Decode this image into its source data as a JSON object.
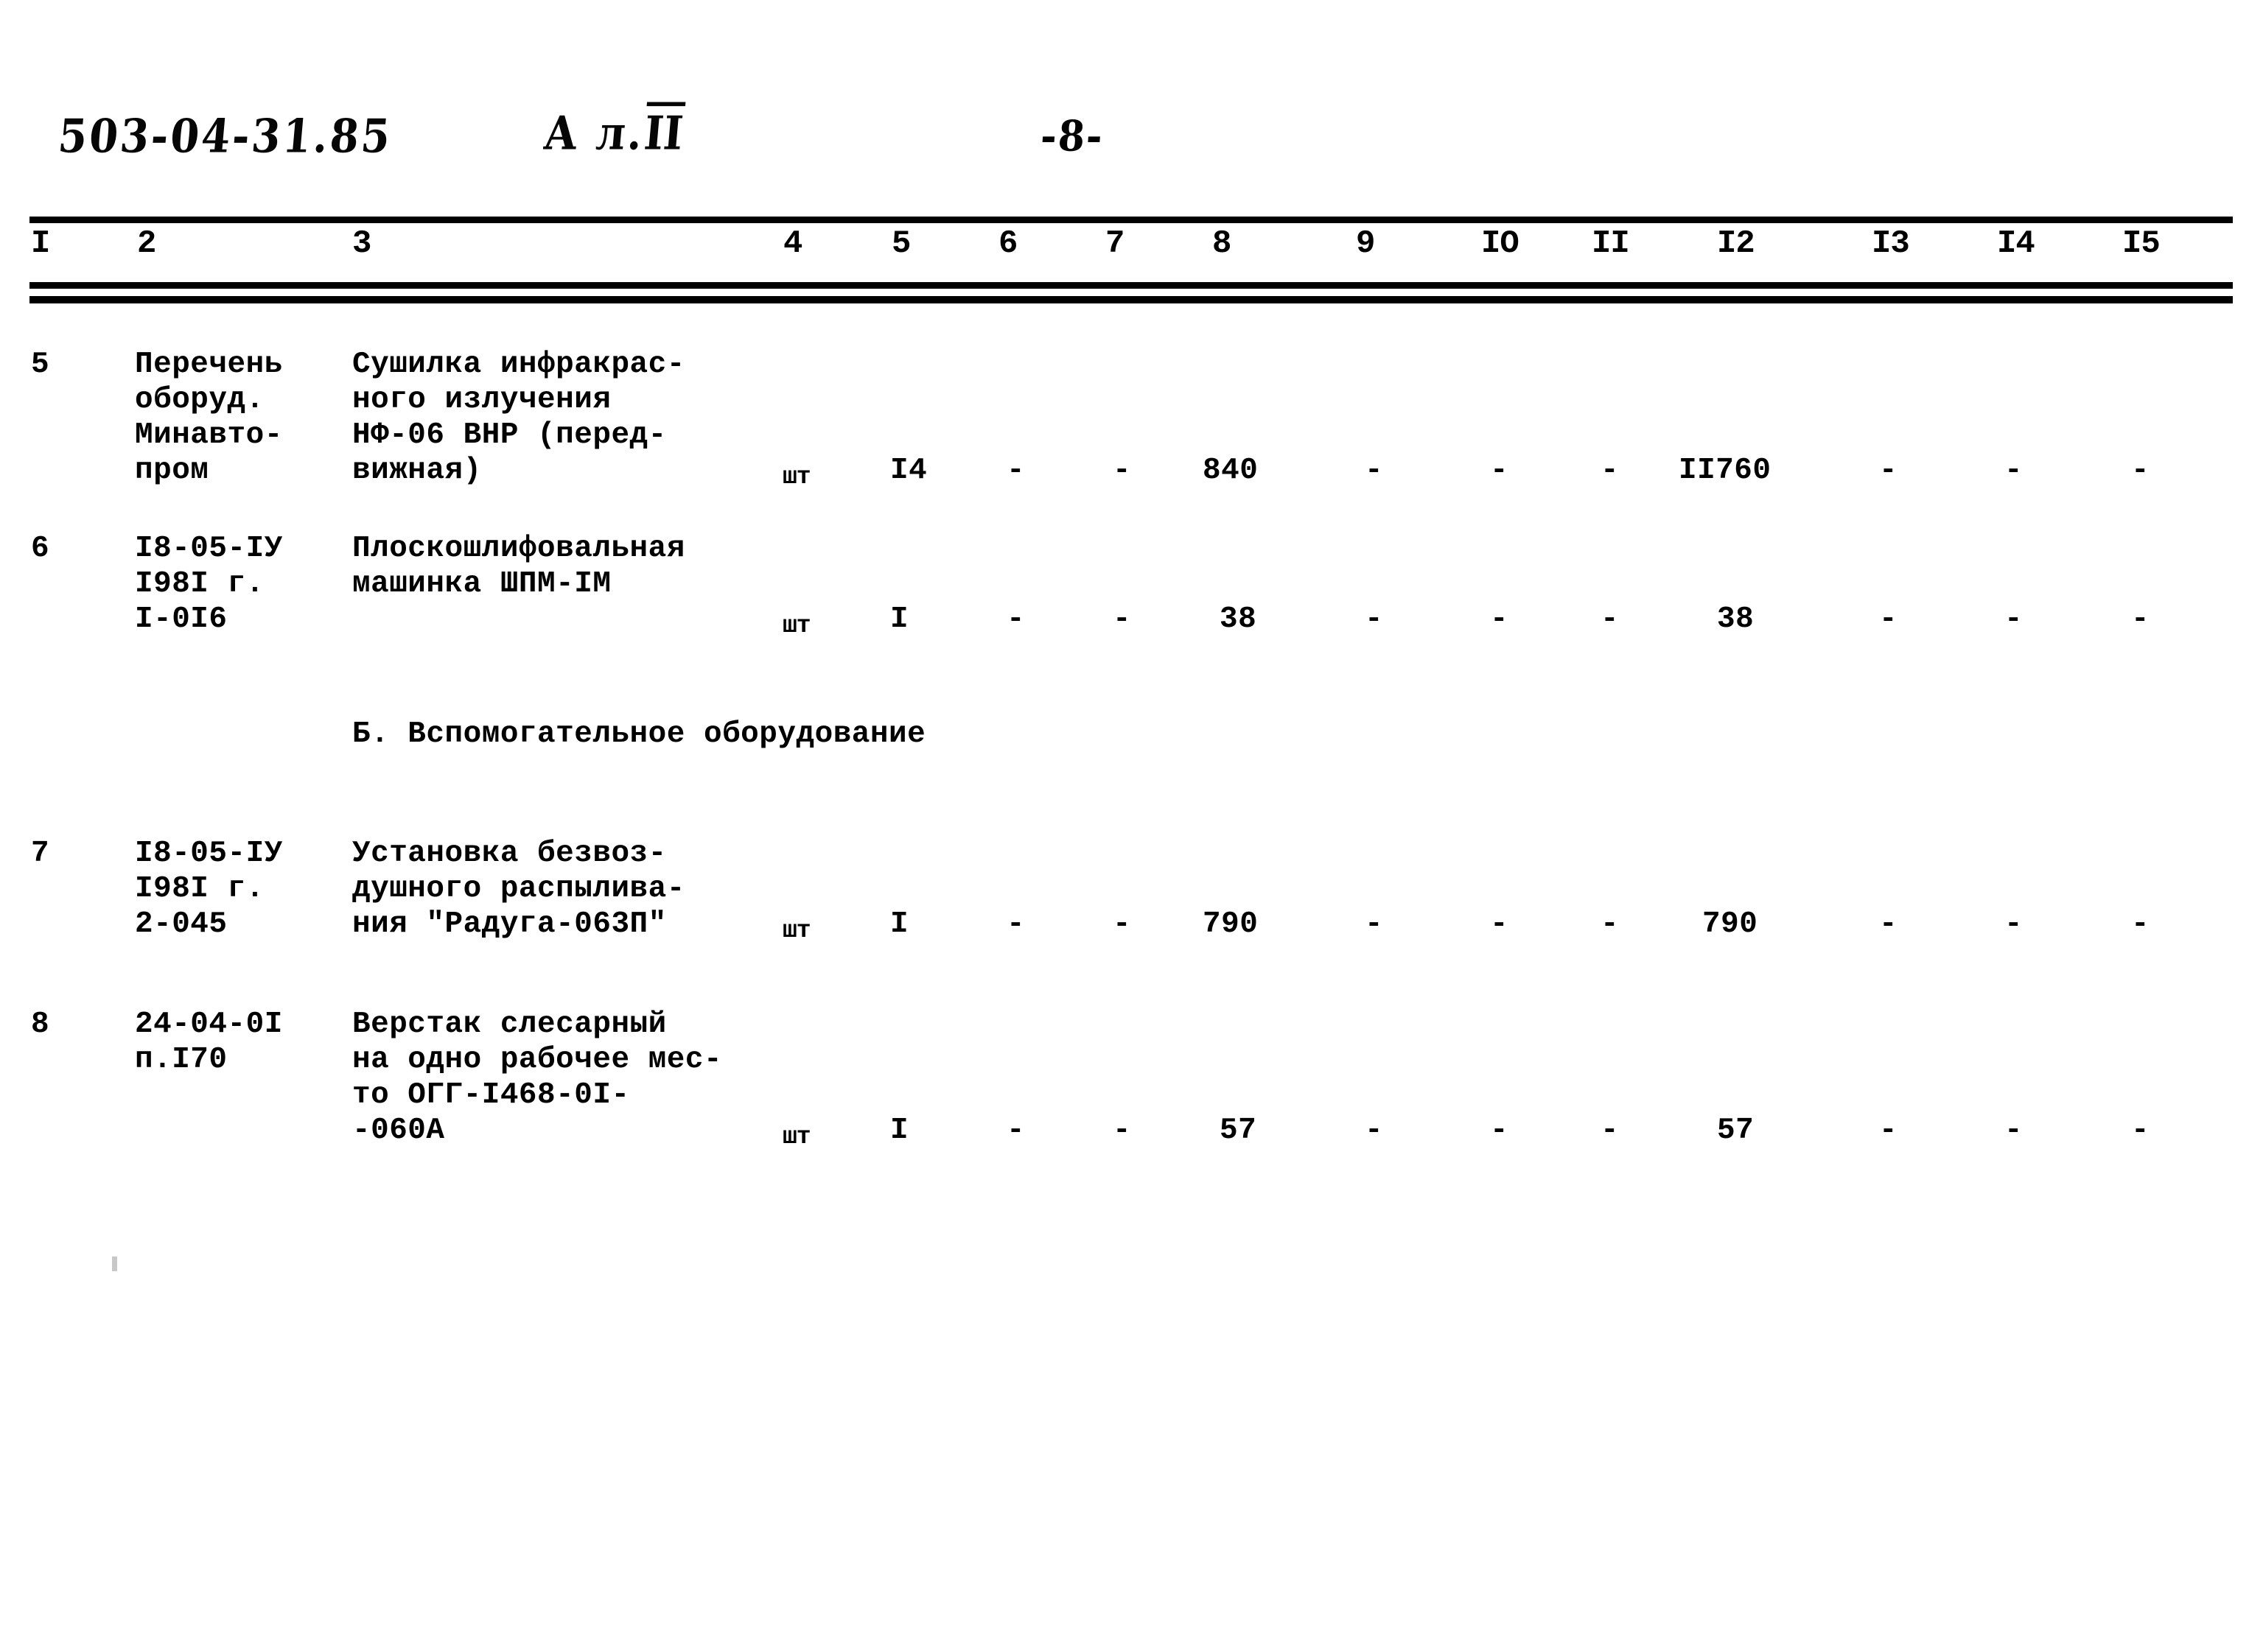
{
  "header": {
    "document_code": "503-04-31.85",
    "album_prefix": "А л.",
    "album_number": "II",
    "page_number": "-8-"
  },
  "table": {
    "column_numbers": [
      "I",
      "2",
      "3",
      "4",
      "5",
      "6",
      "7",
      "8",
      "9",
      "IO",
      "II",
      "I2",
      "I3",
      "I4",
      "I5"
    ],
    "rows": [
      {
        "num": "5",
        "source_lines": [
          "Перечень",
          "оборуд.",
          "Минавто-",
          "пром"
        ],
        "name_lines": [
          "Сушилка инфракрас-",
          "ного излучения",
          "НФ-06 ВНР (перед-",
          "вижная)"
        ],
        "unit": "шт",
        "c5": "I4",
        "c6": "-",
        "c7": "-",
        "c8": "840",
        "c9": "-",
        "c10": "-",
        "c11": "-",
        "c12": "II760",
        "c13": "-",
        "c14": "-",
        "c15": "-"
      },
      {
        "num": "6",
        "source_lines": [
          "I8-05-IУ",
          "I98I г.",
          "I-0I6"
        ],
        "name_lines": [
          "Плоскошлифовальная",
          "машинка ШПМ-IМ"
        ],
        "unit": "шт",
        "c5": "I",
        "c6": "-",
        "c7": "-",
        "c8": "38",
        "c9": "-",
        "c10": "-",
        "c11": "-",
        "c12": "38",
        "c13": "-",
        "c14": "-",
        "c15": "-"
      },
      {
        "num": "7",
        "source_lines": [
          "I8-05-IУ",
          "I98I г.",
          "2-045"
        ],
        "name_lines": [
          "Установка безвоз-",
          "душного распылива-",
          "ния \"Радуга-063П\""
        ],
        "unit": "шт",
        "c5": "I",
        "c6": "-",
        "c7": "-",
        "c8": "790",
        "c9": "-",
        "c10": "-",
        "c11": "-",
        "c12": "790",
        "c13": "-",
        "c14": "-",
        "c15": "-"
      },
      {
        "num": "8",
        "source_lines": [
          "24-04-0I",
          "п.I70"
        ],
        "name_lines": [
          "Верстак слесарный",
          "на одно рабочее мес-",
          "то ОГГ-I468-0I-",
          "-060А"
        ],
        "unit": "шт",
        "c5": "I",
        "c6": "-",
        "c7": "-",
        "c8": "57",
        "c9": "-",
        "c10": "-",
        "c11": "-",
        "c12": "57",
        "c13": "-",
        "c14": "-",
        "c15": "-"
      }
    ],
    "section_heading": "Б. Вспомогательное оборудование"
  }
}
